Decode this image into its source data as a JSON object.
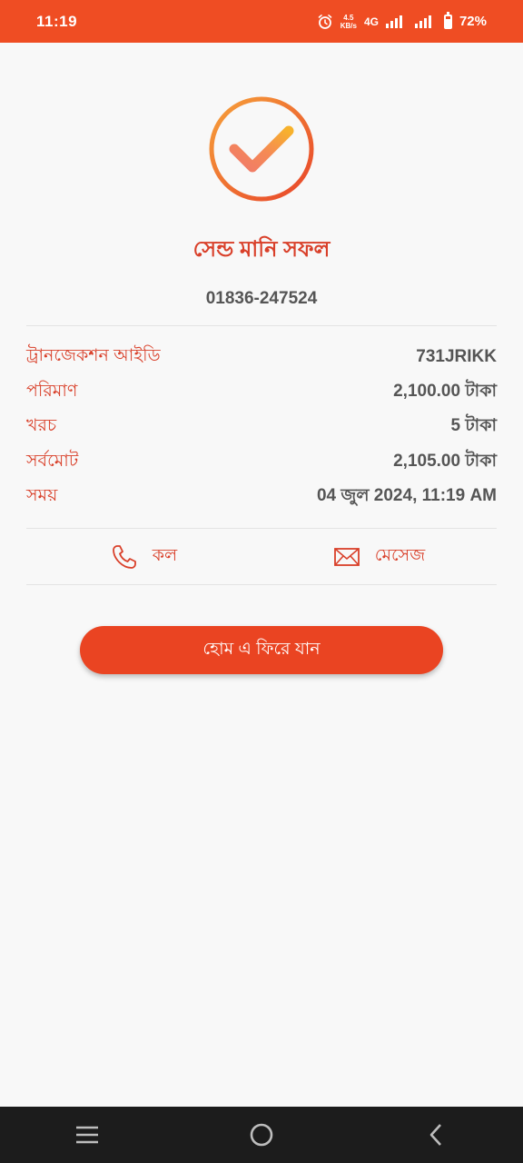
{
  "status_bar": {
    "time": "11:19",
    "speed_value": "4.5",
    "speed_unit": "KB/s",
    "network": "4G",
    "battery": "72%"
  },
  "screen": {
    "title": "সেন্ড মানি সফল",
    "recipient_number": "01836-247524"
  },
  "details": [
    {
      "label": "ট্রানজেকশন আইডি",
      "value": "731JRIKK"
    },
    {
      "label": "পরিমাণ",
      "value": "2,100.00 টাকা"
    },
    {
      "label": "খরচ",
      "value": "5 টাকা"
    },
    {
      "label": "সর্বমোট",
      "value": "2,105.00 টাকা"
    },
    {
      "label": "সময়",
      "value": "04 জুল 2024, 11:19 AM"
    }
  ],
  "actions": {
    "call_label": "কল",
    "call_icon": "phone-icon",
    "message_label": "মেসেজ",
    "message_icon": "envelope-icon"
  },
  "home_button_label": "হোম এ ফিরে যান",
  "colors": {
    "brand": "#ef4d23",
    "accent_text": "#d9402a",
    "button": "#ea4422"
  }
}
